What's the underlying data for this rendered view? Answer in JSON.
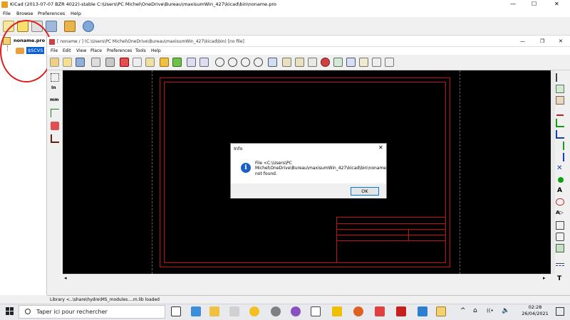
{
  "outer": {
    "title": "KiCad (2013-07-07 BZR 4022)-stable C:\\Users\\PC Michel\\OneDrive\\Bureau\\maxisumWin_427\\kicad\\bin\\noname.pro",
    "menu": [
      "File",
      "Browse",
      "Preferences",
      "Help"
    ],
    "controls": [
      "—",
      "☐",
      "✕"
    ]
  },
  "tree": {
    "project": "noname.pro",
    "child": "$SCVS"
  },
  "inner": {
    "title": "[ noname / ] (C:\\Users\\PC Michel\\OneDrive\\Bureau\\maxisumWin_427\\kicad\\bin) [no file]",
    "menu": [
      "File",
      "Edit",
      "View",
      "Place",
      "Preferences",
      "Tools",
      "Help"
    ],
    "left_tools": [
      "In",
      "mm"
    ],
    "controls": [
      "—",
      "❐",
      "✕"
    ]
  },
  "dialog": {
    "title": "Info",
    "close": "✕",
    "message": "File <C:\\Users\\PC Michel\\OneDrive\\Bureau\\maxisumWin_427\\kicad\\bin\\noname.sch> not found.",
    "ok_label": "OK",
    "icon": "i"
  },
  "status": {
    "text": "Library <..\\share\\hydre\\MS_modules....m.lib loaded"
  },
  "taskbar": {
    "search_placeholder": "Taper ici pour rechercher",
    "time": "02:28",
    "date": "26/04/2021",
    "tray": [
      "^",
      "⌂",
      "((•",
      "🔈"
    ]
  },
  "colors": {
    "sheet_border": "#c01010",
    "annotation_circle": "#e02020",
    "info_icon": "#1a5fc4"
  }
}
